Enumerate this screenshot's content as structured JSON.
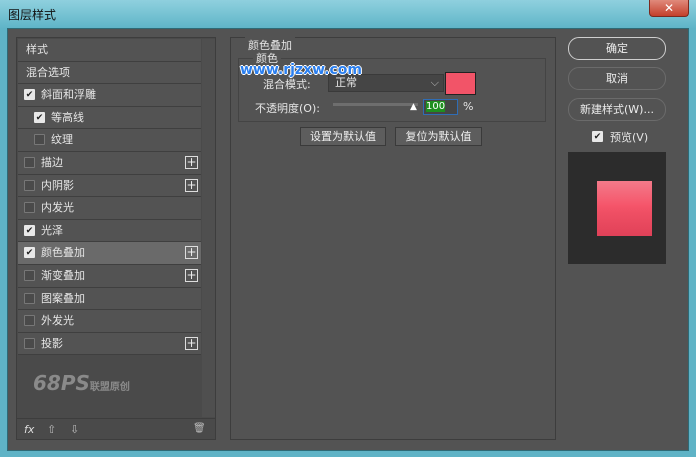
{
  "window": {
    "title": "图层样式",
    "close": "✕"
  },
  "styles_list": [
    {
      "label": "样式",
      "checkbox": null,
      "plus": false
    },
    {
      "label": "混合选项",
      "checkbox": null,
      "plus": false
    },
    {
      "label": "斜面和浮雕",
      "checkbox": true,
      "plus": false
    },
    {
      "label": "等高线",
      "checkbox": true,
      "plus": false,
      "indent": true
    },
    {
      "label": "纹理",
      "checkbox": false,
      "plus": false,
      "indent": true
    },
    {
      "label": "描边",
      "checkbox": false,
      "plus": true
    },
    {
      "label": "内阴影",
      "checkbox": false,
      "plus": true
    },
    {
      "label": "内发光",
      "checkbox": false,
      "plus": false
    },
    {
      "label": "光泽",
      "checkbox": true,
      "plus": false
    },
    {
      "label": "颜色叠加",
      "checkbox": true,
      "plus": true,
      "selected": true
    },
    {
      "label": "渐变叠加",
      "checkbox": false,
      "plus": true
    },
    {
      "label": "图案叠加",
      "checkbox": false,
      "plus": false
    },
    {
      "label": "外发光",
      "checkbox": false,
      "plus": false
    },
    {
      "label": "投影",
      "checkbox": false,
      "plus": true
    }
  ],
  "watermark": {
    "logo": "68PS",
    "text": "联盟原创",
    "site": "www.rjzxw.com"
  },
  "toolbar": {
    "fx": "fx",
    "up": "⇧",
    "down": "⇩",
    "trash": "🗑"
  },
  "panel": {
    "title": "颜色叠加",
    "group": "颜色",
    "blend_label": "混合模式:",
    "blend_value": "正常",
    "color": "#f25468",
    "opacity_label": "不透明度(O):",
    "opacity_value": "100",
    "opacity_unit": "%",
    "set_default": "设置为默认值",
    "reset_default": "复位为默认值"
  },
  "right": {
    "ok": "确定",
    "cancel": "取消",
    "new_style": "新建样式(W)...",
    "preview_label": "预览(V)",
    "preview_checked": true
  }
}
